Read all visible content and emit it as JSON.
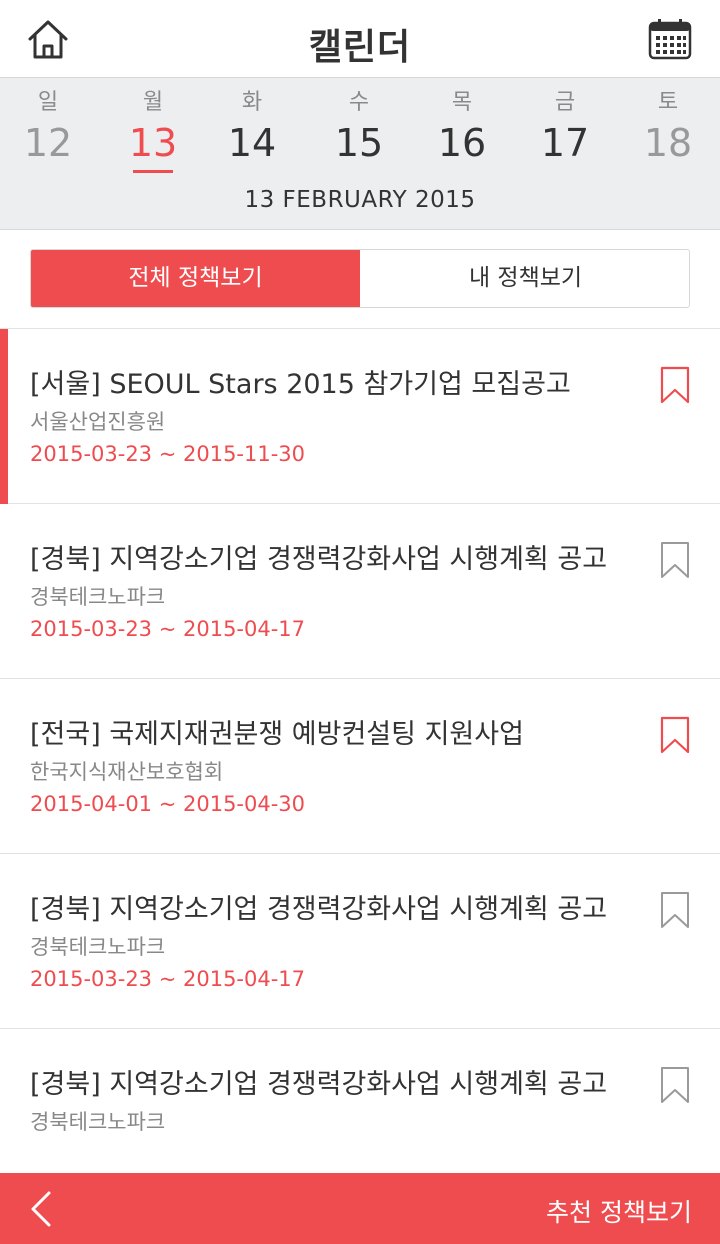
{
  "header": {
    "title": "캘린더",
    "home_icon": "home-icon",
    "calendar_icon": "calendar-icon"
  },
  "week": {
    "days": [
      {
        "name": "일",
        "date": "12"
      },
      {
        "name": "월",
        "date": "13"
      },
      {
        "name": "화",
        "date": "14"
      },
      {
        "name": "수",
        "date": "15"
      },
      {
        "name": "목",
        "date": "16"
      },
      {
        "name": "금",
        "date": "17"
      },
      {
        "name": "토",
        "date": "18"
      }
    ],
    "selected_date": "13",
    "date_label": "13  FEBRUARY 2015"
  },
  "tabs": {
    "all": "전체 정책보기",
    "mine": "내 정책보기",
    "active": "all"
  },
  "items": [
    {
      "title": "[서울] SEOUL Stars 2015 참가기업 모집공고",
      "org": "서울산업진흥원",
      "period": "2015-03-23 ~ 2015-11-30",
      "bookmarked": true
    },
    {
      "title": "[경북] 지역강소기업 경쟁력강화사업 시행계획 공고",
      "org": "경북테크노파크",
      "period": "2015-03-23 ~ 2015-04-17",
      "bookmarked": false
    },
    {
      "title": "[전국] 국제지재권분쟁 예방컨설팅 지원사업",
      "org": "한국지식재산보호협회",
      "period": "2015-04-01 ~ 2015-04-30",
      "bookmarked": true
    },
    {
      "title": "[경북] 지역강소기업 경쟁력강화사업 시행계획 공고",
      "org": "경북테크노파크",
      "period": "2015-03-23 ~ 2015-04-17",
      "bookmarked": false
    },
    {
      "title": "[경북] 지역강소기업 경쟁력강화사업 시행계획 공고",
      "org": "경북테크노파크",
      "period": "",
      "bookmarked": false
    }
  ],
  "footer": {
    "recommend": "추천 정책보기",
    "back_icon": "chevron-left-icon"
  },
  "colors": {
    "accent": "#ef4c4f",
    "week_bg": "#edeef0",
    "bookmark_off": "#9a9a9a"
  }
}
